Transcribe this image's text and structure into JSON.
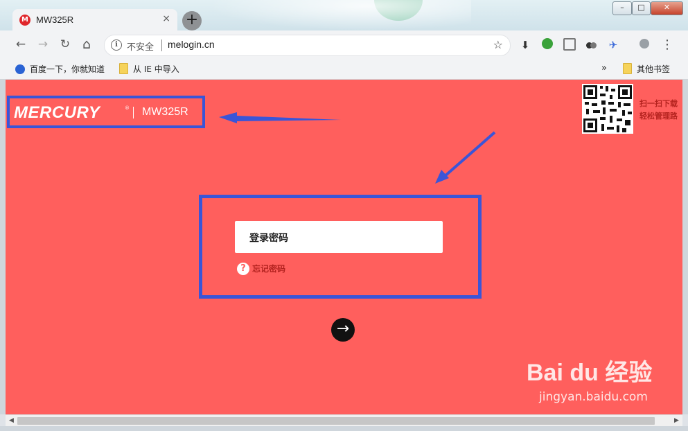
{
  "browser": {
    "tab": {
      "favicon": "M",
      "title": "MW325R",
      "close": "×"
    },
    "new_tab": "+",
    "window_controls": {
      "minimize": "–",
      "maximize": "□",
      "close": "✕"
    },
    "toolbar": {
      "back_icon": "←",
      "forward_icon": "→",
      "reload_icon": "↻",
      "home_icon": "⌂",
      "security_label": "不安全",
      "url": "melogin.cn",
      "star_icon": "☆",
      "menu_icon": "⋮"
    },
    "bookmarks": {
      "items": [
        "百度一下，你就知道",
        "从 IE 中导入"
      ],
      "overflow": "»",
      "other": "其他书签"
    }
  },
  "page": {
    "brand": "MERCURY",
    "brand_mark": "®",
    "model": "MW325R",
    "qr_caption": [
      "扫一扫下载",
      "轻松管理路"
    ],
    "login": {
      "password_label": "登录密码",
      "forgot_icon": "?",
      "forgot_label": "忘记密码",
      "submit_icon": "→"
    },
    "annotation_color": "#3a55d8",
    "background_color": "#ff5f5d"
  },
  "watermark": {
    "brand": "Bai du 经验",
    "url": "jingyan.baidu.com"
  }
}
